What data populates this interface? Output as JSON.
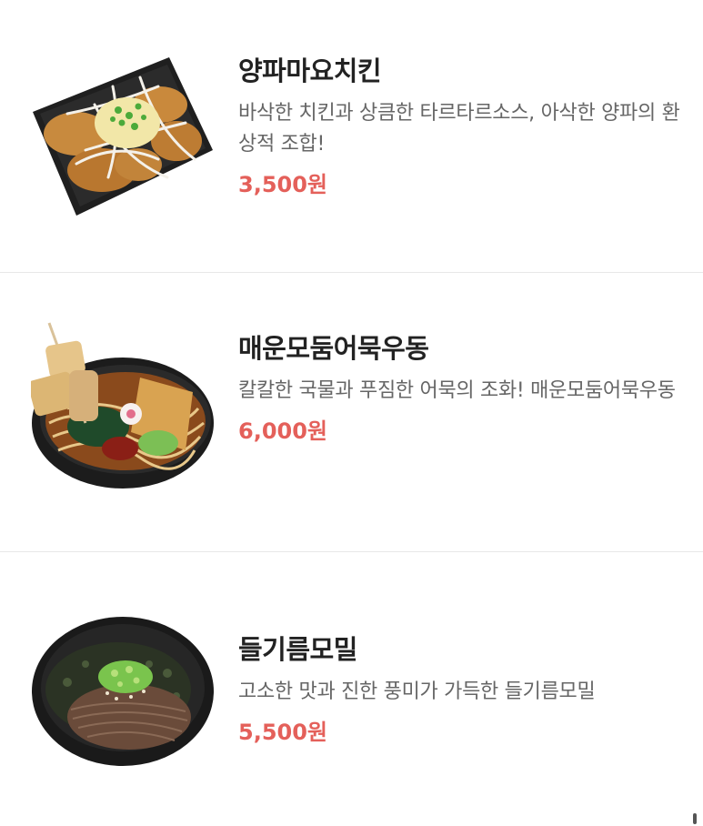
{
  "menu": {
    "items": [
      {
        "name": "양파마요치킨",
        "description": "바삭한 치킨과 상큼한 타르타르소스, 아삭한 양파의 환상적 조합!",
        "price": "3,500원",
        "image_icon": "fried-chicken-dish-icon"
      },
      {
        "name": "매운모둠어묵우동",
        "description": "칼칼한 국물과 푸짐한 어묵의 조화! 매운모둠어묵우동",
        "price": "6,000원",
        "image_icon": "udon-bowl-icon"
      },
      {
        "name": "들기름모밀",
        "description": "고소한 맛과 진한 풍미가 가득한 들기름모밀",
        "price": "5,500원",
        "image_icon": "soba-bowl-icon"
      }
    ]
  },
  "colors": {
    "price": "#e4605a",
    "name": "#222222",
    "description": "#666666",
    "divider": "#e8e8e8"
  }
}
